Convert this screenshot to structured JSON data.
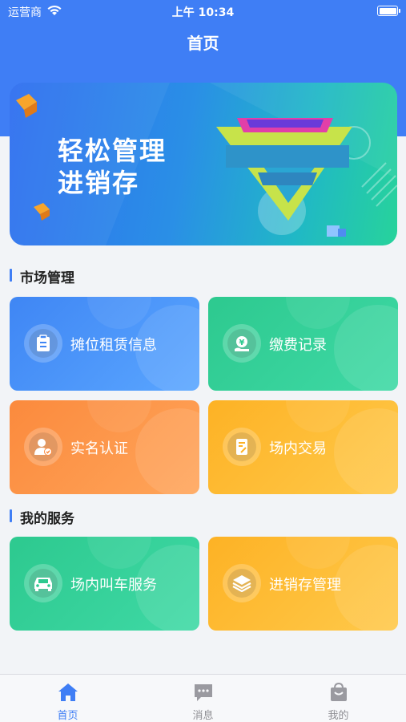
{
  "status_bar": {
    "carrier": "运营商",
    "time": "上午 10:34"
  },
  "header": {
    "title": "首页"
  },
  "banner": {
    "line1": "轻松管理",
    "line2": "进销存"
  },
  "sections": {
    "market": {
      "title": "市场管理",
      "tiles": [
        {
          "label": "摊位租赁信息",
          "icon": "clipboard-icon"
        },
        {
          "label": "缴费记录",
          "icon": "yuan-payment-icon"
        },
        {
          "label": "实名认证",
          "icon": "user-verified-icon"
        },
        {
          "label": "场内交易",
          "icon": "trade-document-icon"
        }
      ]
    },
    "services": {
      "title": "我的服务",
      "tiles": [
        {
          "label": "场内叫车服务",
          "icon": "taxi-icon"
        },
        {
          "label": "进销存管理",
          "icon": "layers-icon"
        }
      ]
    }
  },
  "tabbar": [
    {
      "label": "首页",
      "icon": "home-icon",
      "active": true
    },
    {
      "label": "消息",
      "icon": "message-icon",
      "active": false
    },
    {
      "label": "我的",
      "icon": "bag-icon",
      "active": false
    }
  ],
  "colors": {
    "primary": "#3f7ef5",
    "blue_tile": "#3f86f4",
    "green_tile": "#2dc98f",
    "orange_tile": "#fb8a3d",
    "yellow_tile": "#fdb225"
  }
}
